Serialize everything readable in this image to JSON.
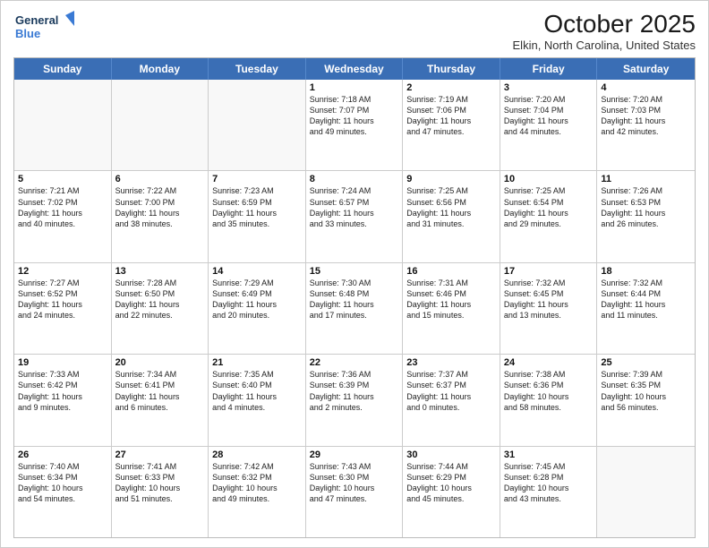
{
  "logo": {
    "line1": "General",
    "line2": "Blue"
  },
  "title": "October 2025",
  "location": "Elkin, North Carolina, United States",
  "header_days": [
    "Sunday",
    "Monday",
    "Tuesday",
    "Wednesday",
    "Thursday",
    "Friday",
    "Saturday"
  ],
  "weeks": [
    [
      {
        "day": "",
        "info": ""
      },
      {
        "day": "",
        "info": ""
      },
      {
        "day": "",
        "info": ""
      },
      {
        "day": "1",
        "info": "Sunrise: 7:18 AM\nSunset: 7:07 PM\nDaylight: 11 hours\nand 49 minutes."
      },
      {
        "day": "2",
        "info": "Sunrise: 7:19 AM\nSunset: 7:06 PM\nDaylight: 11 hours\nand 47 minutes."
      },
      {
        "day": "3",
        "info": "Sunrise: 7:20 AM\nSunset: 7:04 PM\nDaylight: 11 hours\nand 44 minutes."
      },
      {
        "day": "4",
        "info": "Sunrise: 7:20 AM\nSunset: 7:03 PM\nDaylight: 11 hours\nand 42 minutes."
      }
    ],
    [
      {
        "day": "5",
        "info": "Sunrise: 7:21 AM\nSunset: 7:02 PM\nDaylight: 11 hours\nand 40 minutes."
      },
      {
        "day": "6",
        "info": "Sunrise: 7:22 AM\nSunset: 7:00 PM\nDaylight: 11 hours\nand 38 minutes."
      },
      {
        "day": "7",
        "info": "Sunrise: 7:23 AM\nSunset: 6:59 PM\nDaylight: 11 hours\nand 35 minutes."
      },
      {
        "day": "8",
        "info": "Sunrise: 7:24 AM\nSunset: 6:57 PM\nDaylight: 11 hours\nand 33 minutes."
      },
      {
        "day": "9",
        "info": "Sunrise: 7:25 AM\nSunset: 6:56 PM\nDaylight: 11 hours\nand 31 minutes."
      },
      {
        "day": "10",
        "info": "Sunrise: 7:25 AM\nSunset: 6:54 PM\nDaylight: 11 hours\nand 29 minutes."
      },
      {
        "day": "11",
        "info": "Sunrise: 7:26 AM\nSunset: 6:53 PM\nDaylight: 11 hours\nand 26 minutes."
      }
    ],
    [
      {
        "day": "12",
        "info": "Sunrise: 7:27 AM\nSunset: 6:52 PM\nDaylight: 11 hours\nand 24 minutes."
      },
      {
        "day": "13",
        "info": "Sunrise: 7:28 AM\nSunset: 6:50 PM\nDaylight: 11 hours\nand 22 minutes."
      },
      {
        "day": "14",
        "info": "Sunrise: 7:29 AM\nSunset: 6:49 PM\nDaylight: 11 hours\nand 20 minutes."
      },
      {
        "day": "15",
        "info": "Sunrise: 7:30 AM\nSunset: 6:48 PM\nDaylight: 11 hours\nand 17 minutes."
      },
      {
        "day": "16",
        "info": "Sunrise: 7:31 AM\nSunset: 6:46 PM\nDaylight: 11 hours\nand 15 minutes."
      },
      {
        "day": "17",
        "info": "Sunrise: 7:32 AM\nSunset: 6:45 PM\nDaylight: 11 hours\nand 13 minutes."
      },
      {
        "day": "18",
        "info": "Sunrise: 7:32 AM\nSunset: 6:44 PM\nDaylight: 11 hours\nand 11 minutes."
      }
    ],
    [
      {
        "day": "19",
        "info": "Sunrise: 7:33 AM\nSunset: 6:42 PM\nDaylight: 11 hours\nand 9 minutes."
      },
      {
        "day": "20",
        "info": "Sunrise: 7:34 AM\nSunset: 6:41 PM\nDaylight: 11 hours\nand 6 minutes."
      },
      {
        "day": "21",
        "info": "Sunrise: 7:35 AM\nSunset: 6:40 PM\nDaylight: 11 hours\nand 4 minutes."
      },
      {
        "day": "22",
        "info": "Sunrise: 7:36 AM\nSunset: 6:39 PM\nDaylight: 11 hours\nand 2 minutes."
      },
      {
        "day": "23",
        "info": "Sunrise: 7:37 AM\nSunset: 6:37 PM\nDaylight: 11 hours\nand 0 minutes."
      },
      {
        "day": "24",
        "info": "Sunrise: 7:38 AM\nSunset: 6:36 PM\nDaylight: 10 hours\nand 58 minutes."
      },
      {
        "day": "25",
        "info": "Sunrise: 7:39 AM\nSunset: 6:35 PM\nDaylight: 10 hours\nand 56 minutes."
      }
    ],
    [
      {
        "day": "26",
        "info": "Sunrise: 7:40 AM\nSunset: 6:34 PM\nDaylight: 10 hours\nand 54 minutes."
      },
      {
        "day": "27",
        "info": "Sunrise: 7:41 AM\nSunset: 6:33 PM\nDaylight: 10 hours\nand 51 minutes."
      },
      {
        "day": "28",
        "info": "Sunrise: 7:42 AM\nSunset: 6:32 PM\nDaylight: 10 hours\nand 49 minutes."
      },
      {
        "day": "29",
        "info": "Sunrise: 7:43 AM\nSunset: 6:30 PM\nDaylight: 10 hours\nand 47 minutes."
      },
      {
        "day": "30",
        "info": "Sunrise: 7:44 AM\nSunset: 6:29 PM\nDaylight: 10 hours\nand 45 minutes."
      },
      {
        "day": "31",
        "info": "Sunrise: 7:45 AM\nSunset: 6:28 PM\nDaylight: 10 hours\nand 43 minutes."
      },
      {
        "day": "",
        "info": ""
      }
    ]
  ]
}
